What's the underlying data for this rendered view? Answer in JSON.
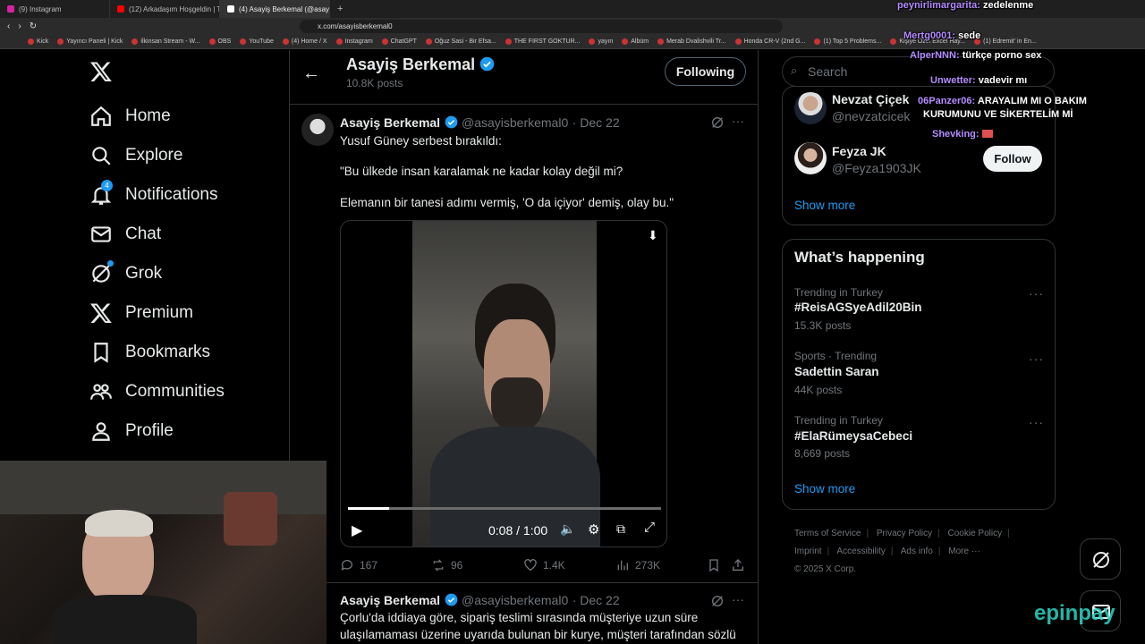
{
  "browser": {
    "tabs": [
      {
        "title": "(9) Instagram",
        "color": "#d6249f"
      },
      {
        "title": "(12) Arkadaşım Hoşgeldin | Taş Devri",
        "color": "#ff0000"
      },
      {
        "title": "(4) Asayiş Berkemal (@asayişb...",
        "color": "#ffffff",
        "active": true
      }
    ],
    "url": "x.com/asayisberkemal0",
    "bookmarks": [
      "Kick",
      "Yayıncı Paneli | Kick",
      "ilkinsan Stream - W...",
      "OBS",
      "YouTube",
      "(4) Home / X",
      "Instagram",
      "ChatGPT",
      "Oğuz Sasi - Bir Efsa...",
      "THE FIRST GOKTUR...",
      "yayın",
      "Albüm",
      "Merab Dvalishvili Tr...",
      "Honda CR-V (2nd G...",
      "(1) Top 5 Problems...",
      "Kişiye Özel Excel Hay...",
      "(1) Edremit' in En..."
    ],
    "all_bookmarks": "All Bookmarks"
  },
  "nav": {
    "items": [
      {
        "label": "Home",
        "icon": "home-icon"
      },
      {
        "label": "Explore",
        "icon": "search-icon"
      },
      {
        "label": "Notifications",
        "icon": "bell-icon",
        "badge": "4"
      },
      {
        "label": "Chat",
        "icon": "mail-icon"
      },
      {
        "label": "Grok",
        "icon": "grok-icon"
      },
      {
        "label": "Premium",
        "icon": "x-logo-icon"
      },
      {
        "label": "Bookmarks",
        "icon": "bookmark-icon"
      },
      {
        "label": "Communities",
        "icon": "communities-icon"
      },
      {
        "label": "Profile",
        "icon": "person-icon"
      }
    ]
  },
  "profile_header": {
    "name": "Asayiş Berkemal",
    "posts": "10.8K posts",
    "follow_label": "Following"
  },
  "tweet1": {
    "name": "Asayiş Berkemal",
    "handle": "@asayisberkemal0",
    "date": "· Dec 22",
    "lines": [
      "Yusuf Güney serbest bırakıldı:",
      "\"Bu ülkede insan karalamak ne kadar kolay değil mi?",
      "Elemanın bir tanesi adımı vermiş, 'O da içiyor' demiş, olay bu.\""
    ],
    "video": {
      "time": "0:08 / 1:00",
      "progress": 0.13
    },
    "stats": {
      "replies": "167",
      "reposts": "96",
      "likes": "1.4K",
      "views": "273K"
    }
  },
  "tweet2": {
    "name": "Asayiş Berkemal",
    "handle": "@asayisberkemal0",
    "date": "· Dec 22",
    "lines": [
      "Çorlu'da iddiaya göre, sipariş teslimi sırasında müşteriye uzun süre",
      "ulaşılamaması üzerine uyarıda bulunan bir kurye, müşteri tarafından sözlü"
    ]
  },
  "right": {
    "search_placeholder": "Search",
    "who_to_follow": [
      {
        "name": "Nevzat Çiçek",
        "handle": "@nevzatcicek"
      },
      {
        "name": "Feyza JK",
        "handle": "@Feyza1903JK",
        "button": "Follow"
      }
    ],
    "show_more": "Show more",
    "trends_title": "What’s happening",
    "trends": [
      {
        "context": "Trending in Turkey",
        "tag": "#ReisAGSyeAdil20Bin",
        "posts": "15.3K posts"
      },
      {
        "context": "Sports · Trending",
        "tag": "Sadettin Saran",
        "posts": "44K posts"
      },
      {
        "context": "Trending in Turkey",
        "tag": "#ElaRümeysaCebeci",
        "posts": "8,669 posts"
      }
    ],
    "footer": [
      "Terms of Service",
      "Privacy Policy",
      "Cookie Policy",
      "Imprint",
      "Accessibility",
      "Ads info",
      "More ···",
      "© 2025 X Corp."
    ]
  },
  "chat_overlay": [
    {
      "user": "peynirlimargarita:",
      "msg": "zedelenme"
    },
    {
      "user": "Mertg0001:",
      "msg": "sede"
    },
    {
      "user": "AlperNNN:",
      "msg": "türkçe porno sex"
    },
    {
      "user": "Unwetter:",
      "msg": "vadevir mı"
    },
    {
      "user": "06Panzer06:",
      "msg": "ARAYALIM MI O BAKIM"
    },
    {
      "user": "",
      "msg": "KURUMUNU VE SİKERTELİM Mİ"
    },
    {
      "user": "Shevking:",
      "msg": ""
    }
  ],
  "watermark": "epinpay",
  "colors": {
    "accent": "#1d9bf0",
    "bg": "#000000",
    "muted": "#71767b",
    "border": "#2f3336"
  }
}
